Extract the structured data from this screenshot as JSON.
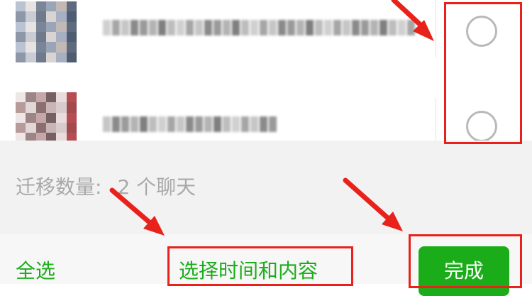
{
  "contacts": [
    {
      "selected": false
    },
    {
      "selected": false
    }
  ],
  "migration": {
    "count_label": "迁移数量:",
    "count_value": "2 个聊天"
  },
  "bottom_bar": {
    "select_all_label": "全选",
    "select_time_content_label": "选择时间和内容",
    "done_label": "完成"
  },
  "colors": {
    "accent_green": "#1aad19",
    "annotation_red": "#e8221b",
    "radio_border": "#b9b9b9",
    "muted_text": "#a9a9a9"
  }
}
